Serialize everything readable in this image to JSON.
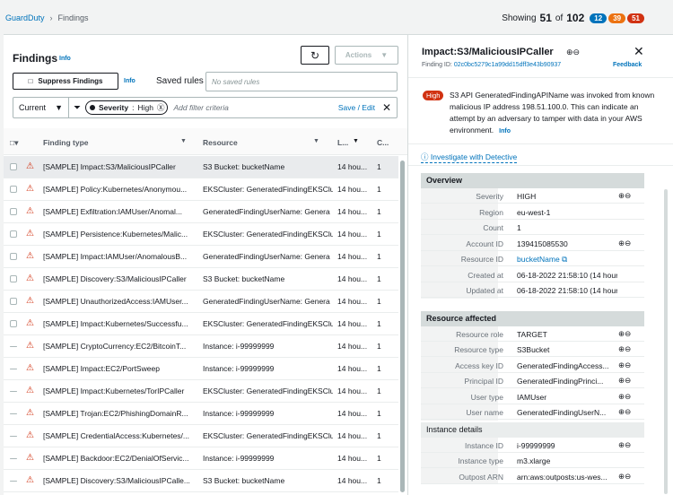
{
  "breadcrumb": {
    "root": "GuardDuty",
    "current": "Findings"
  },
  "showing": {
    "label": "Showing",
    "count": "51",
    "of": "of",
    "total": "102",
    "counts": [
      {
        "value": "12",
        "color": "#0073bb"
      },
      {
        "value": "39",
        "color": "#ec7211"
      },
      {
        "value": "51",
        "color": "#d13212"
      }
    ]
  },
  "findings": {
    "title": "Findings",
    "info": "Info",
    "actions": "Actions",
    "suppress": "Suppress Findings",
    "suppress_info": "Info",
    "saved_rules_label": "Saved rules",
    "saved_rules_placeholder": "No saved rules",
    "current": "Current",
    "token_key": "Severity",
    "token_value": "High",
    "filter_placeholder": "Add filter criteria",
    "save_edit": "Save / Edit"
  },
  "table": {
    "columns": [
      "Finding type",
      "Resource",
      "L...",
      "C..."
    ],
    "rows": [
      {
        "type": "[SAMPLE] Impact:S3/MaliciousIPCaller",
        "resource": "S3 Bucket: bucketName",
        "last": "14 hou...",
        "count": "1",
        "selected": true,
        "checkbox": true
      },
      {
        "type": "[SAMPLE] Policy:Kubernetes/Anonymou...",
        "resource": "EKSCluster: GeneratedFindingEKSClu",
        "last": "14 hou...",
        "count": "1",
        "checkbox": true
      },
      {
        "type": "[SAMPLE] Exfiltration:IAMUser/Anomal...",
        "resource": "GeneratedFindingUserName: Genera",
        "last": "14 hou...",
        "count": "1",
        "checkbox": true
      },
      {
        "type": "[SAMPLE] Persistence:Kubernetes/Malic...",
        "resource": "EKSCluster: GeneratedFindingEKSClu",
        "last": "14 hou...",
        "count": "1",
        "checkbox": true
      },
      {
        "type": "[SAMPLE] Impact:IAMUser/AnomalousB...",
        "resource": "GeneratedFindingUserName: Genera",
        "last": "14 hou...",
        "count": "1",
        "checkbox": true
      },
      {
        "type": "[SAMPLE] Discovery:S3/MaliciousIPCaller",
        "resource": "S3 Bucket: bucketName",
        "last": "14 hou...",
        "count": "1",
        "checkbox": true
      },
      {
        "type": "[SAMPLE] UnauthorizedAccess:IAMUser...",
        "resource": "GeneratedFindingUserName: Genera",
        "last": "14 hou...",
        "count": "1",
        "checkbox": true
      },
      {
        "type": "[SAMPLE] Impact:Kubernetes/Successfu...",
        "resource": "EKSCluster: GeneratedFindingEKSClu",
        "last": "14 hou...",
        "count": "1",
        "checkbox": true
      },
      {
        "type": "[SAMPLE] CryptoCurrency:EC2/BitcoinT...",
        "resource": "Instance: i-99999999",
        "last": "14 hou...",
        "count": "1",
        "checkbox": false
      },
      {
        "type": "[SAMPLE] Impact:EC2/PortSweep",
        "resource": "Instance: i-99999999",
        "last": "14 hou...",
        "count": "1",
        "checkbox": false
      },
      {
        "type": "[SAMPLE] Impact:Kubernetes/TorIPCaller",
        "resource": "EKSCluster: GeneratedFindingEKSClu",
        "last": "14 hou...",
        "count": "1",
        "checkbox": false
      },
      {
        "type": "[SAMPLE] Trojan:EC2/PhishingDomainR...",
        "resource": "Instance: i-99999999",
        "last": "14 hou...",
        "count": "1",
        "checkbox": false
      },
      {
        "type": "[SAMPLE] CredentialAccess:Kubernetes/...",
        "resource": "EKSCluster: GeneratedFindingEKSClu",
        "last": "14 hou...",
        "count": "1",
        "checkbox": false
      },
      {
        "type": "[SAMPLE] Backdoor:EC2/DenialOfServic...",
        "resource": "Instance: i-99999999",
        "last": "14 hou...",
        "count": "1",
        "checkbox": false
      },
      {
        "type": "[SAMPLE] Discovery:S3/MaliciousIPCalle...",
        "resource": "S3 Bucket: bucketName",
        "last": "14 hou...",
        "count": "1",
        "checkbox": false
      }
    ]
  },
  "detail": {
    "title": "Impact:S3/MaliciousIPCaller",
    "finding_id_label": "Finding ID:",
    "finding_id": "02c0bc5279c1a99dd15dff3e43b90937",
    "feedback": "Feedback",
    "severity_badge": "High",
    "description": "S3 API GeneratedFindingAPIName was invoked from known malicious IP address 198.51.100.0. This can indicate an attempt by an adversary to tamper with data in your AWS environment.",
    "description_info": "Info",
    "investigate": "Investigate with Detective",
    "overview_header": "Overview",
    "overview": [
      {
        "k": "Severity",
        "v": "HIGH",
        "zoom": true
      },
      {
        "k": "Region",
        "v": "eu-west-1"
      },
      {
        "k": "Count",
        "v": "1"
      },
      {
        "k": "Account ID",
        "v": "139415085530",
        "zoom": true
      },
      {
        "k": "Resource ID",
        "v": "bucketName",
        "link": true
      },
      {
        "k": "Created at",
        "v": "06-18-2022 21:58:10 (14 hours..."
      },
      {
        "k": "Updated at",
        "v": "06-18-2022 21:58:10 (14 hours..."
      }
    ],
    "resource_header": "Resource affected",
    "resource": [
      {
        "k": "Resource role",
        "v": "TARGET",
        "zoom": true
      },
      {
        "k": "Resource type",
        "v": "S3Bucket",
        "zoom": true
      },
      {
        "k": "Access key ID",
        "v": "GeneratedFindingAccess...",
        "zoom": true
      },
      {
        "k": "Principal ID",
        "v": "GeneratedFindingPrinci...",
        "zoom": true
      },
      {
        "k": "User type",
        "v": "IAMUser",
        "zoom": true
      },
      {
        "k": "User name",
        "v": "GeneratedFindingUserN...",
        "zoom": true
      }
    ],
    "instance_header": "Instance details",
    "instance": [
      {
        "k": "Instance ID",
        "v": "i-99999999",
        "zoom": true
      },
      {
        "k": "Instance type",
        "v": "m3.xlarge"
      },
      {
        "k": "Outpost ARN",
        "v": "arn:aws:outposts:us-wes...",
        "zoom": true
      }
    ]
  }
}
